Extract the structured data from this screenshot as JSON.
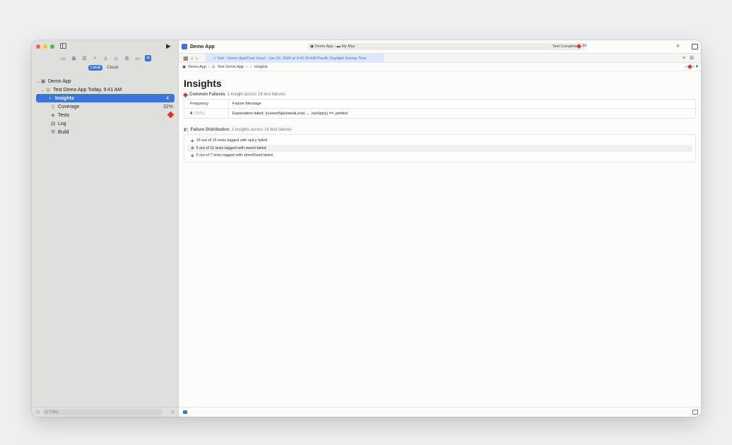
{
  "sidebar": {
    "seg_local": "Local",
    "seg_cloud": "Cloud",
    "project": "Demo App",
    "test_run": "Test Demo App",
    "test_run_time": "Today, 9:41 AM",
    "items": [
      {
        "label": "Insights",
        "badge": "4"
      },
      {
        "label": "Coverage",
        "badge": "32%"
      },
      {
        "label": "Tests",
        "badge": ""
      },
      {
        "label": "Log",
        "badge": ""
      },
      {
        "label": "Build",
        "badge": ""
      }
    ],
    "filter_placeholder": "Filter"
  },
  "titlebar": {
    "app_name": "Demo App",
    "scheme": "Demo App",
    "destination": "My Mac",
    "status": "Test Completed",
    "error_count": "10"
  },
  "tab": {
    "title": "Test - Demo App/Core Food - Jun 10, 2024 at 9:41:00 AM Pacific Daylight Saving Time"
  },
  "breadcrumb": [
    "Demo App",
    "Test Demo App",
    "Insights"
  ],
  "content": {
    "title": "Insights",
    "common": {
      "heading": "Common Failures",
      "subtitle": "1 insight across 16 test failures",
      "col_frequency": "Frequency",
      "col_message": "Failure Message",
      "row_count": "4",
      "row_pct": "(25%)",
      "row_message": "Expectation failed: (currentSpicinessLevel → .tooSpicy) == .perfect"
    },
    "distribution": {
      "heading": "Failure Distribution",
      "subtitle": "3 insights across 16 test failures",
      "items": [
        "15 out of 15 tests tagged with spicy failed",
        "5 out of 11 tests tagged with sweet failed",
        "2 out of 7 tests tagged with streetFood failed"
      ]
    }
  },
  "colors": {
    "accent": "#3d74d9",
    "error": "#d93636"
  }
}
